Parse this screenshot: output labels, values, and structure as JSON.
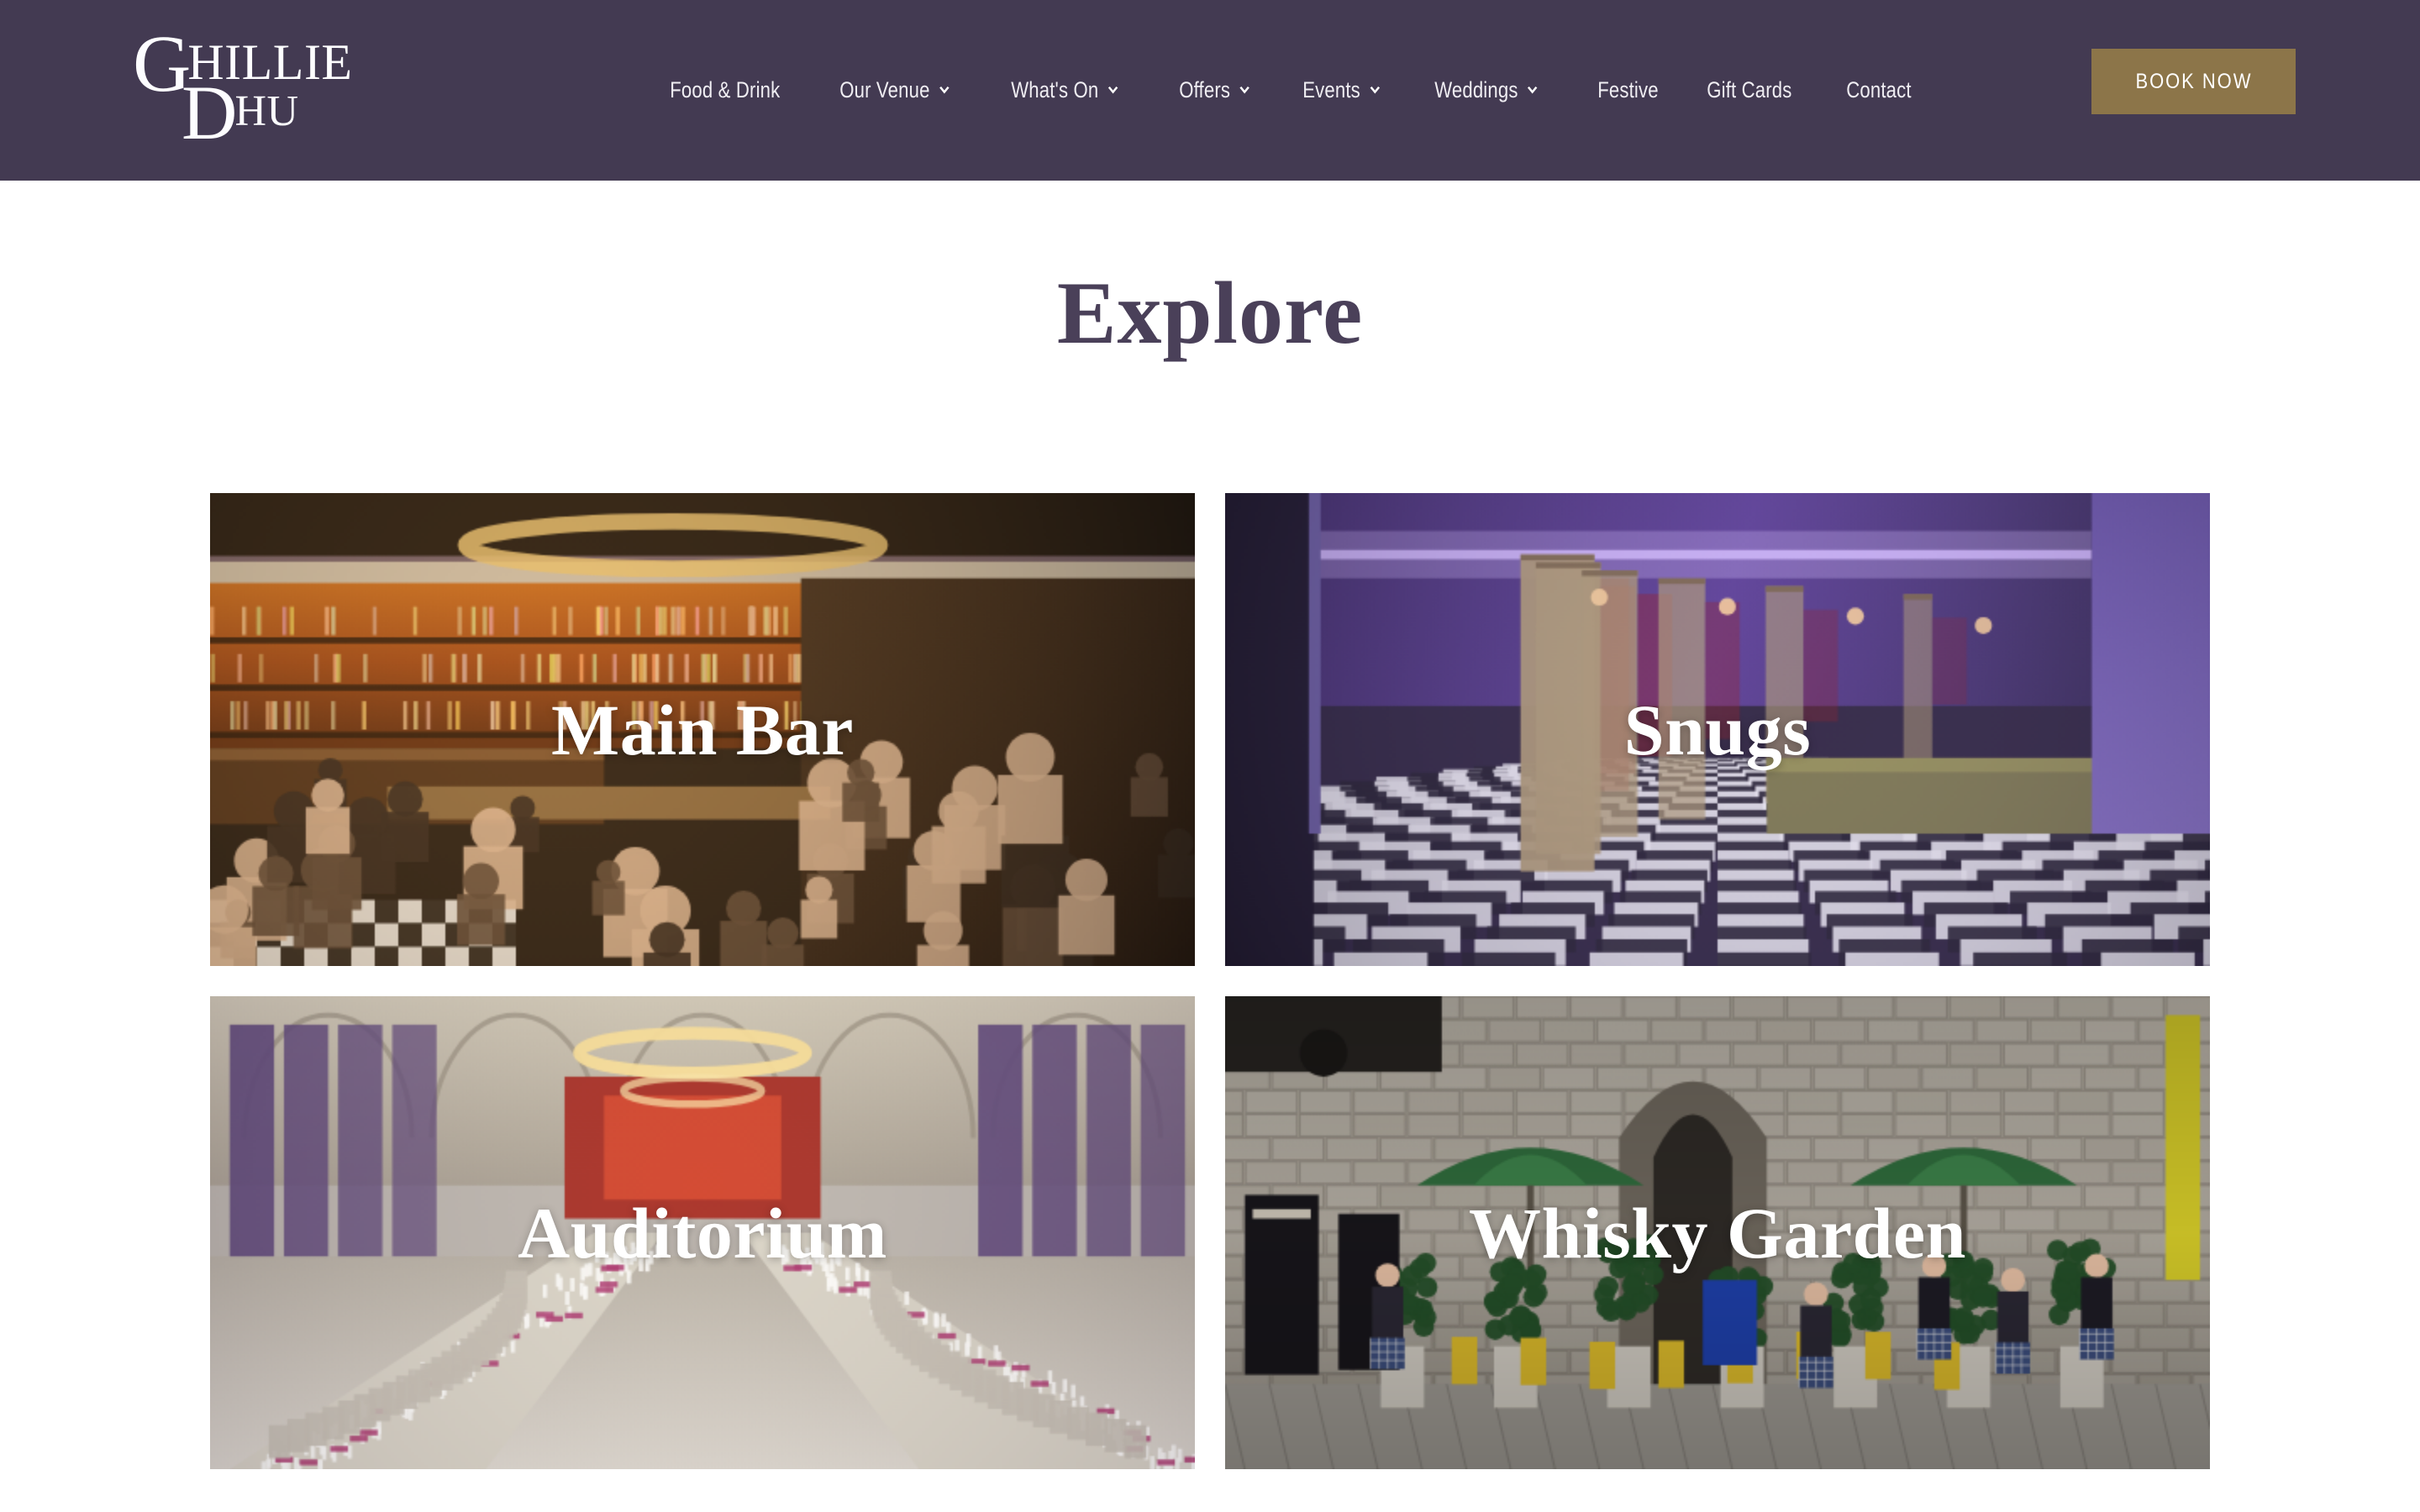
{
  "header": {
    "background_color": "#433a52",
    "logo": {
      "name": "ghillie-dhu-logo",
      "line1_drop": "G",
      "line1_rest": "HILLIE",
      "line2_drop": "D",
      "line2_rest": "HU",
      "alt": "Ghillie Dhu"
    },
    "nav": [
      {
        "label": "Food & Drink",
        "has_dropdown": false
      },
      {
        "label": "Our Venue",
        "has_dropdown": true
      },
      {
        "label": "What's On",
        "has_dropdown": true
      },
      {
        "label": "Offers",
        "has_dropdown": true
      },
      {
        "label": "Events",
        "has_dropdown": true
      },
      {
        "label": "Weddings",
        "has_dropdown": true
      },
      {
        "label": "Festive",
        "has_dropdown": false
      },
      {
        "label": "Gift Cards",
        "has_dropdown": false
      },
      {
        "label": "Contact",
        "has_dropdown": false
      }
    ],
    "cta": {
      "label": "BOOK NOW",
      "background_color": "#8c7549",
      "text_color": "#ffffff"
    }
  },
  "main": {
    "title": "Explore",
    "title_color": "#4a4059",
    "cards": [
      {
        "id": "main-bar",
        "title": "Main Bar",
        "scene": "bar-interior",
        "alt": "Busy pub interior with long wooden bar, bottle shelves, chandeliers and seated guests"
      },
      {
        "id": "snugs",
        "title": "Snugs",
        "scene": "snugs-interior",
        "alt": "Row of wooden snug booths lit with purple neon, checkerboard floor"
      },
      {
        "id": "auditorium",
        "title": "Auditorium",
        "scene": "auditorium-interior",
        "alt": "Grand hall set for a banquet with long tables, purple drapes and chandeliers"
      },
      {
        "id": "whisky-garden",
        "title": "Whisky Garden",
        "scene": "whisky-garden-exterior",
        "alt": "Outdoor courtyard with green parasols, gothic stone archway and people in tartan"
      }
    ]
  }
}
